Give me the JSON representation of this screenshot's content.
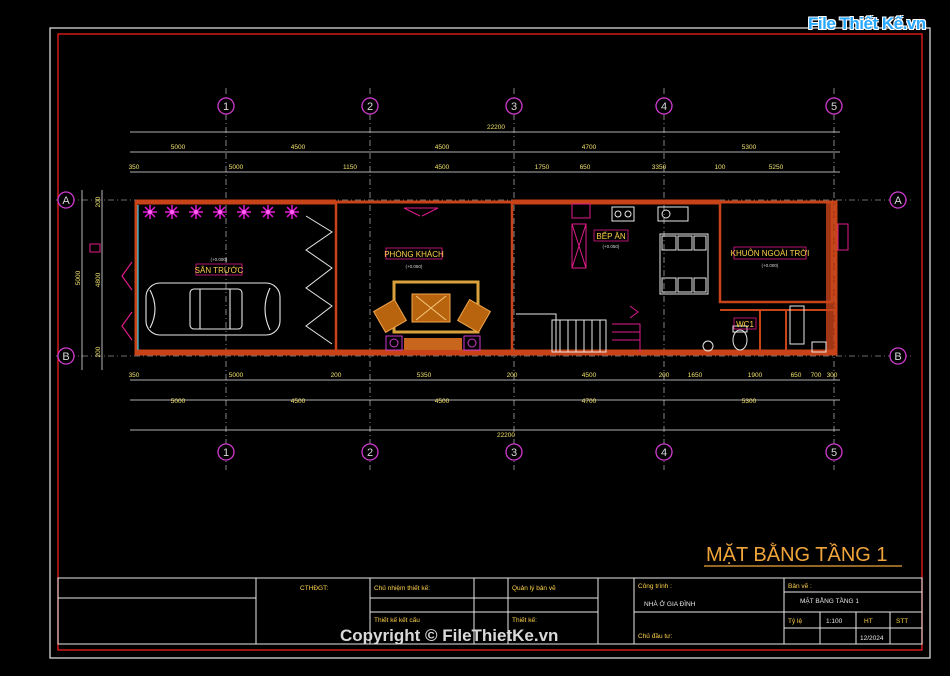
{
  "watermark_logo": "File Thiết Kế.vn",
  "watermark_copyright": "Copyright © FileThietKe.vn",
  "sheet_title": "MẶT BẰNG TẦNG 1",
  "axes_columns": [
    "1",
    "2",
    "3",
    "4",
    "5"
  ],
  "axes_rows": [
    "A",
    "B"
  ],
  "dims_top_total": "22200",
  "dims_top_spans": [
    "5000",
    "4500",
    "4500",
    "4700",
    "5300"
  ],
  "dims_top_detail": [
    "350",
    "5000",
    "1150",
    "4500",
    "1750",
    "650",
    "3350",
    "100",
    "5250"
  ],
  "dims_bottom_detail": [
    "350",
    "5000",
    "200",
    "5350",
    "200",
    "4500",
    "200",
    "1650",
    "1900",
    "650",
    "700",
    "300"
  ],
  "dims_bottom_spans": [
    "5000",
    "4500",
    "4500",
    "4700",
    "5300"
  ],
  "dims_bottom_total": "22200",
  "dims_left": [
    "200",
    "5000",
    "4800",
    "200"
  ],
  "rooms": {
    "san_truoc": "SÂN TRƯỚC",
    "phong_khach": "PHÒNG KHÁCH",
    "bep_an": "BẾP ĂN",
    "khuon_vien": "KHUÔN NGOÀI TRỜI",
    "wc": "WC1"
  },
  "room_levels": {
    "san_truoc": "(+0.000)",
    "phong_khach": "(+0.050)",
    "bep_an": "(+0.050)",
    "khuon_vien": "(+0.000)"
  },
  "title_block": {
    "cthdgt": "CTHĐGT:",
    "chu_nhiem": "Chủ nhiệm thiết kế:",
    "quan_ly": "Quản lý bản vẽ",
    "cong_trinh_label": "Công trình :",
    "cong_trinh_value": "NHÀ Ở GIA ĐÌNH",
    "ban_ve_label": "Bản vẽ :",
    "ban_ve_value": "MẶT BẰNG TẦNG 1",
    "thiet_ke_ket_cau": "Thiết kế kết cấu",
    "thiet_ke": "Thiết kế:",
    "chu_dau_tu": "Chủ đầu tư:",
    "ty_le_label": "Tỷ lệ",
    "ty_le_value": "1:100",
    "ht": "HT",
    "stt": "STT",
    "date": "12/2024"
  }
}
